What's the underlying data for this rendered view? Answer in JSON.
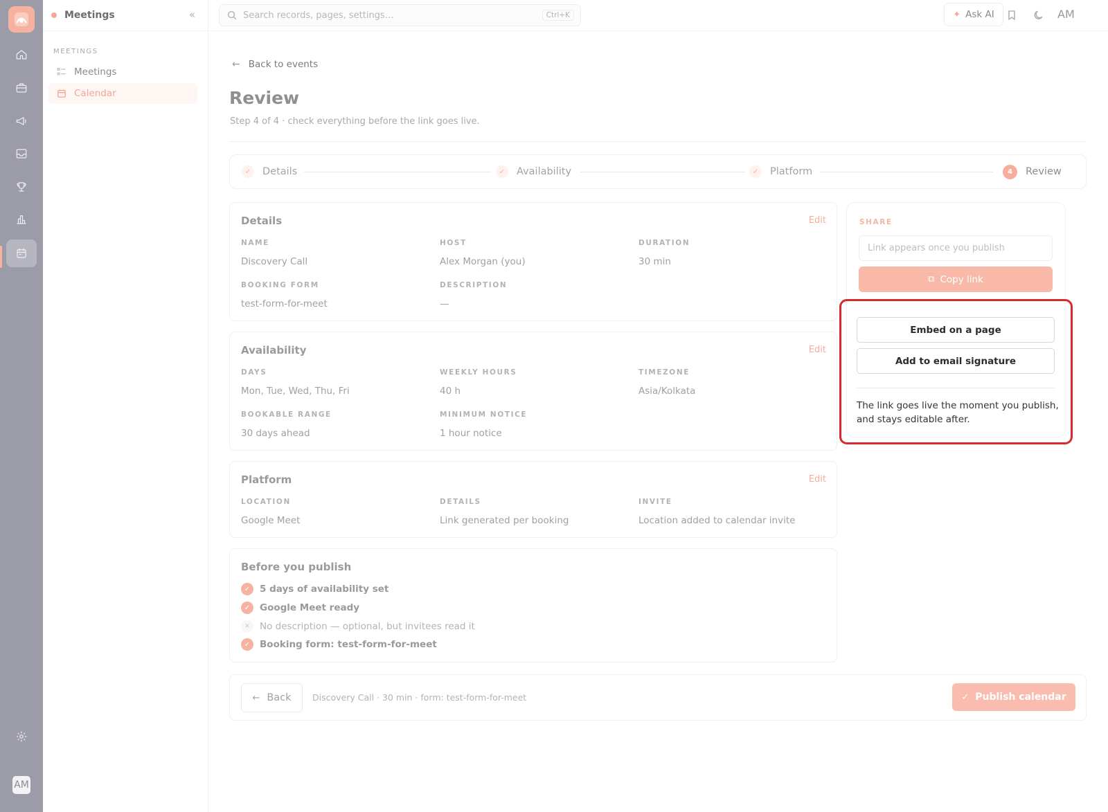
{
  "app": {
    "section_title": "Meetings",
    "accent": "#f6ad9c",
    "highlight": "#d62a2e"
  },
  "rail": {
    "icons": [
      "home-icon",
      "briefcase-icon",
      "megaphone-icon",
      "inbox-icon",
      "trophy-icon",
      "bar-chart-icon",
      "calendar-icon",
      "settings-icon"
    ],
    "active": "calendar-icon",
    "avatar": "AM"
  },
  "sidebar": {
    "title": "Meetings",
    "section": "MEETINGS",
    "items": [
      {
        "label": "Meetings",
        "icon": "list-icon",
        "active": false
      },
      {
        "label": "Calendar",
        "icon": "calendar-icon",
        "active": true
      }
    ]
  },
  "topbar": {
    "search_placeholder": "Search records, pages, settings…",
    "shortcut": "Ctrl+K",
    "ask_ai": "Ask AI",
    "avatar": "AM"
  },
  "page": {
    "back": "Back to events",
    "title": "Review",
    "subtitle": "Step 4 of 4 · check everything before the link goes live."
  },
  "stepper": {
    "steps": [
      {
        "label": "Details",
        "state": "done"
      },
      {
        "label": "Availability",
        "state": "done"
      },
      {
        "label": "Platform",
        "state": "done"
      },
      {
        "label": "Review",
        "state": "current",
        "number": "4"
      }
    ]
  },
  "details": {
    "title": "Details",
    "edit": "Edit",
    "name_label": "NAME",
    "name_value": "Discovery Call",
    "host_label": "HOST",
    "host_value": "Alex Morgan (you)",
    "duration_label": "DURATION",
    "duration_value": "30 min",
    "form_label": "BOOKING FORM",
    "form_value": "test-form-for-meet",
    "description_label": "DESCRIPTION",
    "description_value": "—"
  },
  "availability": {
    "title": "Availability",
    "edit": "Edit",
    "days_label": "DAYS",
    "days_value": "Mon, Tue, Wed, Thu, Fri",
    "hours_label": "WEEKLY HOURS",
    "hours_value": "40 h",
    "tz_label": "TIMEZONE",
    "tz_value": "Asia/Kolkata",
    "range_label": "BOOKABLE RANGE",
    "range_value": "30 days ahead",
    "notice_label": "MINIMUM NOTICE",
    "notice_value": "1 hour notice"
  },
  "platform": {
    "title": "Platform",
    "edit": "Edit",
    "location_label": "LOCATION",
    "location_value": "Google Meet",
    "details_label": "DETAILS",
    "details_value": "Link generated per booking",
    "invite_label": "INVITE",
    "invite_value": "Location added to calendar invite"
  },
  "checklist": {
    "title": "Before you publish",
    "items": [
      {
        "text": "5 days of availability set",
        "ok": true
      },
      {
        "text": "Google Meet ready",
        "ok": true
      },
      {
        "text": "No description — optional, but invitees read it",
        "ok": false
      },
      {
        "text": "Booking form: test-form-for-meet",
        "ok": true
      }
    ]
  },
  "share": {
    "label": "SHARE",
    "link_placeholder": "Link appears once you publish",
    "copy": "Copy link",
    "embed": "Embed on a page",
    "signature": "Add to email signature",
    "note": "The link goes live the moment you publish, and stays editable after."
  },
  "footer": {
    "back": "Back",
    "summary": "Discovery Call · 30 min · form: test-form-for-meet",
    "publish": "Publish calendar"
  }
}
